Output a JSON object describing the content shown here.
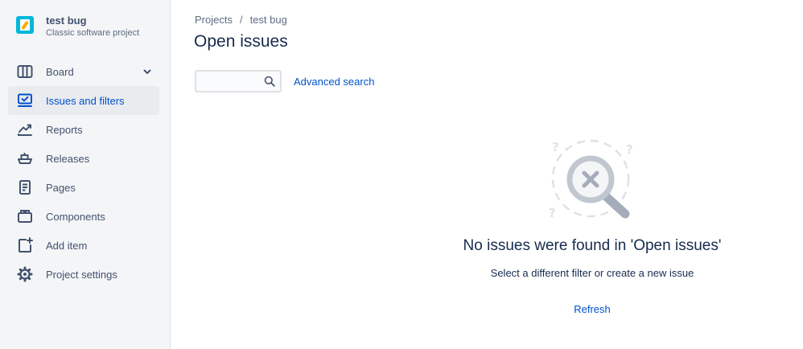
{
  "project": {
    "name": "test bug",
    "type": "Classic software project"
  },
  "sidebar": {
    "items": [
      {
        "label": "Board",
        "icon": "board-icon",
        "has_chevron": true
      },
      {
        "label": "Issues and filters",
        "icon": "issues-icon",
        "active": true
      },
      {
        "label": "Reports",
        "icon": "reports-icon"
      },
      {
        "label": "Releases",
        "icon": "releases-icon"
      },
      {
        "label": "Pages",
        "icon": "pages-icon"
      },
      {
        "label": "Components",
        "icon": "components-icon"
      },
      {
        "label": "Add item",
        "icon": "add-item-icon"
      },
      {
        "label": "Project settings",
        "icon": "gear-icon"
      }
    ]
  },
  "breadcrumb": {
    "items": [
      "Projects",
      "test bug"
    ],
    "separator": "/"
  },
  "page": {
    "title": "Open issues"
  },
  "search": {
    "value": "",
    "advanced_label": "Advanced search"
  },
  "empty_state": {
    "title": "No issues were found in 'Open issues'",
    "description": "Select a different filter or create a new issue",
    "refresh_label": "Refresh"
  },
  "colors": {
    "accent": "#0052cc",
    "sidebar_bg": "#f4f5f7",
    "active_bg": "#e9ebee",
    "text": "#172b4d",
    "project_avatar": "#00b8d9"
  }
}
